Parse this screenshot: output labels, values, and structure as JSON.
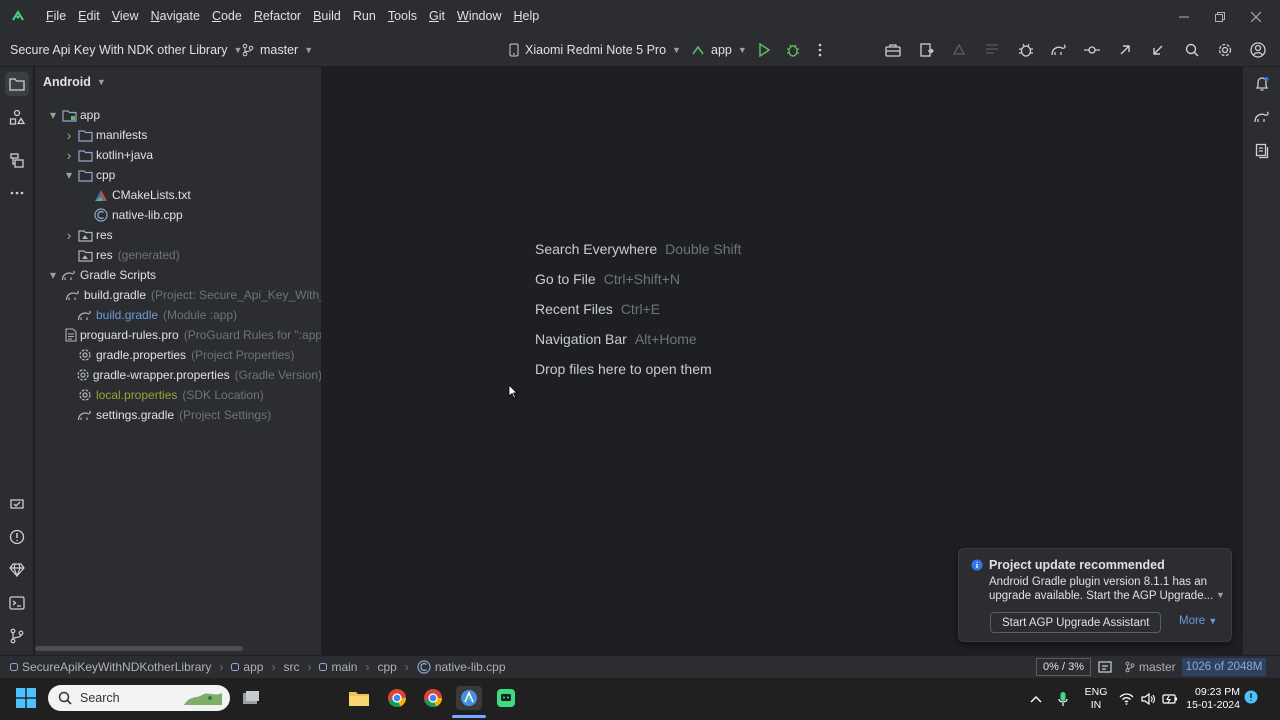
{
  "menu": [
    {
      "label": "File",
      "mn": "F",
      "rest": "ile"
    },
    {
      "label": "Edit",
      "mn": "E",
      "rest": "dit"
    },
    {
      "label": "View",
      "mn": "V",
      "rest": "iew"
    },
    {
      "label": "Navigate",
      "mn": "N",
      "rest": "avigate"
    },
    {
      "label": "Code",
      "mn": "C",
      "rest": "ode"
    },
    {
      "label": "Refactor",
      "mn": "R",
      "rest": "efactor"
    },
    {
      "label": "Build",
      "mn": "B",
      "rest": "uild"
    },
    {
      "label": "Run",
      "mn": "",
      "rest": "Run"
    },
    {
      "label": "Tools",
      "mn": "T",
      "rest": "ools"
    },
    {
      "label": "Git",
      "mn": "G",
      "rest": "it"
    },
    {
      "label": "Window",
      "mn": "W",
      "rest": "indow"
    },
    {
      "label": "Help",
      "mn": "H",
      "rest": "elp"
    }
  ],
  "toolbar": {
    "project_name": "Secure Api Key With NDK other Library",
    "branch": "master",
    "device": "Xiaomi Redmi Note 5 Pro",
    "run_config": "app"
  },
  "project": {
    "view_mode": "Android",
    "tree": [
      {
        "name": "app",
        "hint": "",
        "level": 0,
        "arrow": "open",
        "icon": "module-folder-icon",
        "style": ""
      },
      {
        "name": "manifests",
        "hint": "",
        "level": 1,
        "arrow": "closed",
        "icon": "folder-icon",
        "style": ""
      },
      {
        "name": "kotlin+java",
        "hint": "",
        "level": 1,
        "arrow": "closed",
        "icon": "folder-icon",
        "style": ""
      },
      {
        "name": "cpp",
        "hint": "",
        "level": 1,
        "arrow": "open",
        "icon": "folder-icon",
        "style": ""
      },
      {
        "name": "CMakeLists.txt",
        "hint": "",
        "level": 2,
        "arrow": "",
        "icon": "cmake-icon",
        "style": ""
      },
      {
        "name": "native-lib.cpp",
        "hint": "",
        "level": 2,
        "arrow": "",
        "icon": "cpp-file-icon",
        "style": ""
      },
      {
        "name": "res",
        "hint": "",
        "level": 1,
        "arrow": "closed",
        "icon": "res-folder-icon",
        "style": ""
      },
      {
        "name": "res",
        "hint": "(generated)",
        "level": 1,
        "arrow": "",
        "icon": "res-folder-icon",
        "style": ""
      },
      {
        "name": "Gradle Scripts",
        "hint": "",
        "level": 0,
        "arrow": "open",
        "icon": "gradle-icon",
        "style": ""
      },
      {
        "name": "build.gradle",
        "hint": "(Project: Secure_Api_Key_With_N",
        "level": 1,
        "arrow": "",
        "icon": "gradle-icon",
        "style": ""
      },
      {
        "name": "build.gradle",
        "hint": "(Module :app)",
        "level": 1,
        "arrow": "",
        "icon": "gradle-icon",
        "style": "blue"
      },
      {
        "name": "proguard-rules.pro",
        "hint": "(ProGuard Rules for \":app",
        "level": 1,
        "arrow": "",
        "icon": "file-lines-icon",
        "style": ""
      },
      {
        "name": "gradle.properties",
        "hint": "(Project Properties)",
        "level": 1,
        "arrow": "",
        "icon": "settings-file-icon",
        "style": ""
      },
      {
        "name": "gradle-wrapper.properties",
        "hint": "(Gradle Version)",
        "level": 1,
        "arrow": "",
        "icon": "settings-file-icon",
        "style": ""
      },
      {
        "name": "local.properties",
        "hint": "(SDK Location)",
        "level": 1,
        "arrow": "",
        "icon": "settings-file-icon",
        "style": "olive"
      },
      {
        "name": "settings.gradle",
        "hint": "(Project Settings)",
        "level": 1,
        "arrow": "",
        "icon": "gradle-icon",
        "style": ""
      }
    ]
  },
  "editor_empty": [
    {
      "action": "Search Everywhere",
      "shortcut": "Double Shift"
    },
    {
      "action": "Go to File",
      "shortcut": "Ctrl+Shift+N"
    },
    {
      "action": "Recent Files",
      "shortcut": "Ctrl+E"
    },
    {
      "action": "Navigation Bar",
      "shortcut": "Alt+Home"
    },
    {
      "action": "Drop files here to open them",
      "shortcut": ""
    }
  ],
  "notification": {
    "title": "Project update recommended",
    "body": "Android Gradle plugin version 8.1.1 has an upgrade available. Start the AGP Upgrade...",
    "button": "Start AGP Upgrade Assistant",
    "more": "More"
  },
  "statusbar": {
    "breadcrumb": [
      "SecureApiKeyWithNDKotherLibrary",
      "app",
      "src",
      "main",
      "cpp",
      "native-lib.cpp"
    ],
    "memory": "0% / 3%",
    "branch": "master",
    "heap": "1026 of 2048M"
  },
  "taskbar": {
    "search_placeholder": "Search",
    "language_line1": "ENG",
    "language_line2": "IN",
    "time": "09:23 PM",
    "date": "15-01-2024"
  },
  "colors": {
    "accent_blue": "#3574f0",
    "run_green": "#5fb85f",
    "background": "#1e1f22",
    "panel": "#2b2d30"
  }
}
